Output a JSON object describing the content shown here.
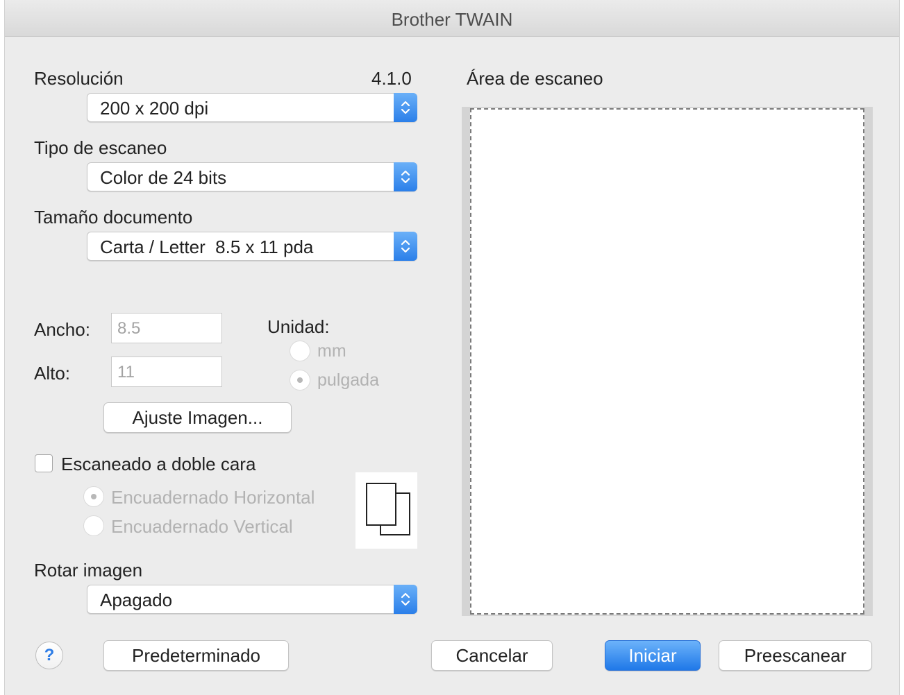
{
  "window": {
    "title": "Brother TWAIN"
  },
  "version": "4.1.0",
  "resolution": {
    "label": "Resolución",
    "value": "200 x 200 dpi"
  },
  "scan_type": {
    "label": "Tipo de escaneo",
    "value": "Color de 24 bits"
  },
  "document_size": {
    "label": "Tamaño documento",
    "value": "Carta / Letter  8.5 x 11 pda"
  },
  "dimensions": {
    "width_label": "Ancho:",
    "width_value": "8.5",
    "height_label": "Alto:",
    "height_value": "11"
  },
  "unit": {
    "label": "Unidad:",
    "options": [
      "mm",
      "pulgada"
    ],
    "selected": "pulgada"
  },
  "image_adjust_button": "Ajuste Imagen...",
  "duplex": {
    "label": "Escaneado a doble cara",
    "checked": false,
    "options": [
      "Encuadernado Horizontal",
      "Encuadernado Vertical"
    ],
    "selected": "Encuadernado Horizontal"
  },
  "rotate": {
    "label": "Rotar imagen",
    "value": "Apagado"
  },
  "scan_area": {
    "label": "Área de escaneo"
  },
  "buttons": {
    "help": "?",
    "default": "Predeterminado",
    "cancel": "Cancelar",
    "start": "Iniciar",
    "prescan": "Preescanear"
  },
  "colors": {
    "accent": "#2b7fe9",
    "disabled_text": "#b2b2b2"
  }
}
